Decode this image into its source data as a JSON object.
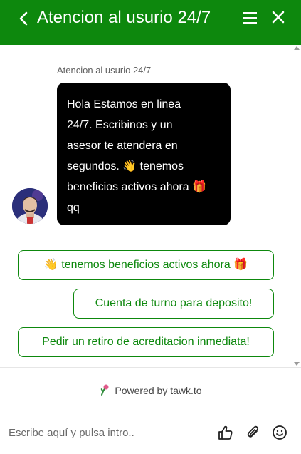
{
  "header": {
    "title": "Atencion al usurio 24/7",
    "back_icon": "chevron-left-icon",
    "menu_icon": "hamburger-menu-icon",
    "close_icon": "close-icon",
    "background_color": "#0d880d"
  },
  "chat": {
    "agent_name": "Atencion al usurio 24/7",
    "message_lines": [
      "Hola Estamos en linea",
      "24/7. Escribinos y un",
      "asesor te atendera en",
      "segundos. 👋 tenemos",
      "beneficios activos ahora 🎁",
      "qq"
    ],
    "avatar_icon": "agent-avatar"
  },
  "quick_replies": [
    "👋 tenemos beneficios activos ahora 🎁",
    "Cuenta de turno para deposito!",
    "Pedir un retiro de acreditacion inmediata!"
  ],
  "footer": {
    "powered_by": "Powered by tawk.to",
    "input_placeholder": "Escribe aquí y pulsa intro..",
    "icons": [
      "thumbs-up-icon",
      "paperclip-icon",
      "emoji-icon"
    ]
  }
}
